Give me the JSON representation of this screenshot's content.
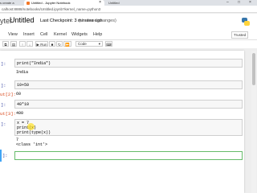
{
  "browser": {
    "tab_left": "s create a",
    "tab_active": "Untitled - Jupyter Notebook",
    "tab_right": "Untitled",
    "url": "calhost:8888/notebooks/Untitled.ipynb?kernel_name=python3"
  },
  "header": {
    "logo_text": "yter",
    "title": "Untitled",
    "checkpoint": "Last Checkpoint: 3 minutes ago",
    "unsaved": "(unsaved changes)"
  },
  "menu": [
    "View",
    "Insert",
    "Cell",
    "Kernel",
    "Widgets",
    "Help"
  ],
  "trusted": "Trusted",
  "toolbar": {
    "run_label": "▶ Run",
    "cell_type": "Code"
  },
  "cells": [
    {
      "in_prompt": "]:",
      "code": "print(\"India\")",
      "out_prompt": "",
      "output": "India"
    },
    {
      "in_prompt": "]:",
      "code": "10+50",
      "out_prompt": "ut[2]:",
      "output": "60"
    },
    {
      "in_prompt": "]:",
      "code": "40*10",
      "out_prompt": "ut[3]:",
      "output": "400"
    },
    {
      "in_prompt": "]:",
      "code_lines": [
        "x = 7",
        "print(x)",
        "print(type(x))"
      ],
      "output_lines": [
        "7",
        "<class 'int'>"
      ]
    },
    {
      "in_prompt": "]:"
    }
  ]
}
